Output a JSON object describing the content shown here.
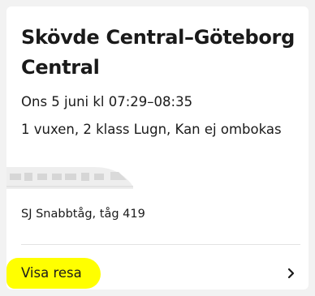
{
  "trip": {
    "title": "Skövde Central–Göteborg Central",
    "date_time": "Ons 5 juni kl 07:29–08:35",
    "passengers": "1 vuxen, 2 klass Lugn, Kan ej ombokas",
    "service": "SJ Snabbtåg, tåg 419"
  },
  "actions": {
    "show_trip_label": "Visa resa",
    "chevron_icon": "chevron-right-icon",
    "highlight_color": "#ffff00"
  },
  "icons": {
    "train": "train-illustration-icon"
  }
}
